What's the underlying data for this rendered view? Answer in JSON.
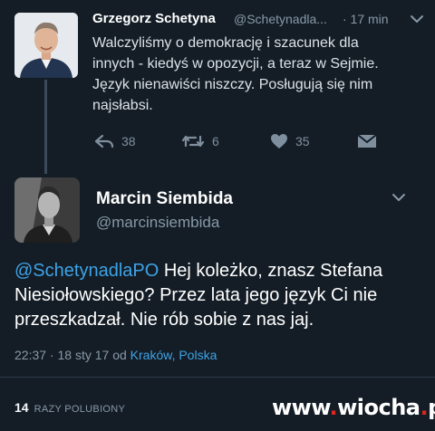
{
  "tweet1": {
    "name": "Grzegorz Schetyna",
    "handle": "@Schetynadla...",
    "time": "· 17 min",
    "lines": [
      "Walczyliśmy o demokrację i szacunek dla",
      "innych - kiedyś w opozycji, a teraz w Sejmie.",
      "Język nienawiści niszczy. Posługują się nim",
      "najsłabsi."
    ],
    "actions": {
      "replies": "38",
      "retweets": "6",
      "likes": "35"
    },
    "icons": [
      "reply-icon",
      "retweet-icon",
      "heart-icon",
      "envelope-icon",
      "chevron-down-icon"
    ]
  },
  "tweet2": {
    "name": "Marcin Siembida",
    "handle": "@marcinsiembida",
    "mention": "@SchetynadlaPO",
    "line1_rest": " Hej koleżko, znasz Stefana",
    "line2": "Niesiołowskiego? Przez lata jego język Ci nie",
    "line3": "przeszkadzał. Nie rób sobie z nas jaj.",
    "timestamp": "22:37 · 18 sty 17",
    "from_label": "od",
    "location": "Kraków, Polska",
    "likes_count": "14",
    "likes_label": "RAZY POLUBIONY"
  },
  "watermark": {
    "prefix": "www",
    "dot1": ".",
    "name": "wiocha",
    "dot2": ".",
    "tld": "pl"
  },
  "colors": {
    "background": "#141d26",
    "link": "#3ea3e6",
    "muted": "#8899a6",
    "watermark_dot": "#e0241e"
  }
}
